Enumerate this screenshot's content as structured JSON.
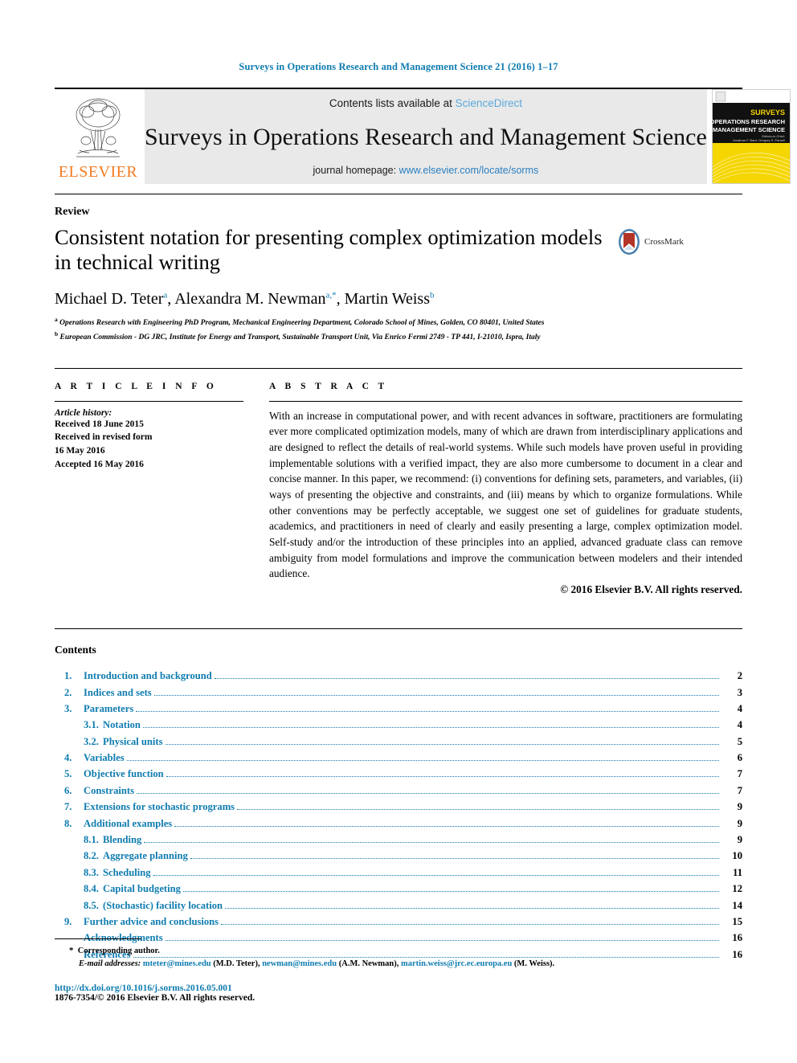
{
  "running_head": "Surveys in Operations Research and Management Science 21 (2016) 1–17",
  "masthead": {
    "publisher_name": "ELSEVIER",
    "contents_prefix": "Contents lists available at ",
    "sciencedirect": "ScienceDirect",
    "journal_title": "Surveys in Operations Research and Management Science",
    "homepage_prefix": "journal homepage: ",
    "homepage_url": "www.elsevier.com/locate/sorms",
    "cover": {
      "line1": "SURVEYS",
      "line2": "in OPERATIONS RESEARCH",
      "line3": "and MANAGEMENT SCIENCE",
      "sub1": "Editors-in-Chief:",
      "sub2": "Jonathan F. Bard, Gregory S. Parnell"
    }
  },
  "article": {
    "type": "Review",
    "title": "Consistent notation for presenting complex optimization models in technical writing",
    "crossmark_label": "CrossMark",
    "authors": [
      {
        "name": "Michael D. Teter",
        "marks": "a"
      },
      {
        "name": "Alexandra M. Newman",
        "marks": "a,*"
      },
      {
        "name": "Martin Weiss",
        "marks": "b"
      }
    ],
    "affiliations": [
      {
        "mark": "a",
        "text": "Operations Research with Engineering PhD Program, Mechanical Engineering Department, Colorado School of Mines, Golden, CO 80401, United States"
      },
      {
        "mark": "b",
        "text": "European Commission - DG JRC, Institute for Energy and Transport, Sustainable Transport Unit, Via Enrico Fermi 2749 - TP 441, I-21010, Ispra, Italy"
      }
    ]
  },
  "article_info": {
    "heading": "A R T I C L E   I N F O",
    "history_label": "Article history:",
    "history": [
      "Received 18 June 2015",
      "Received in revised form",
      "16 May 2016",
      "Accepted 16 May 2016"
    ]
  },
  "abstract": {
    "heading": "A B S T R A C T",
    "body": "With an increase in computational power, and with recent advances in software, practitioners are formulating ever more complicated optimization models, many of which are drawn from interdisciplinary applications and are designed to reflect the details of real-world systems. While such models have proven useful in providing implementable solutions with a verified impact, they are also more cumbersome to document in a clear and concise manner. In this paper, we recommend: (i) conventions for defining sets, parameters, and variables, (ii) ways of presenting the objective and constraints, and (iii) means by which to organize formulations. While other conventions may be perfectly acceptable, we suggest one set of guidelines for graduate students, academics, and practitioners in need of clearly and easily presenting a large, complex optimization model. Self-study and/or the introduction of these principles into an applied, advanced graduate class can remove ambiguity from model formulations and improve the communication between modelers and their intended audience.",
    "copyright": "© 2016 Elsevier B.V. All rights reserved."
  },
  "contents": {
    "title": "Contents",
    "entries": [
      {
        "num": "1.",
        "label": "Introduction and background",
        "page": "2",
        "sub": false
      },
      {
        "num": "2.",
        "label": "Indices and sets",
        "page": "3",
        "sub": false
      },
      {
        "num": "3.",
        "label": "Parameters",
        "page": "4",
        "sub": false
      },
      {
        "num": "3.1.",
        "label": "Notation",
        "page": "4",
        "sub": true
      },
      {
        "num": "3.2.",
        "label": "Physical units",
        "page": "5",
        "sub": true
      },
      {
        "num": "4.",
        "label": "Variables",
        "page": "6",
        "sub": false
      },
      {
        "num": "5.",
        "label": "Objective function",
        "page": "7",
        "sub": false
      },
      {
        "num": "6.",
        "label": "Constraints",
        "page": "7",
        "sub": false
      },
      {
        "num": "7.",
        "label": "Extensions for stochastic programs",
        "page": "9",
        "sub": false
      },
      {
        "num": "8.",
        "label": "Additional examples",
        "page": "9",
        "sub": false
      },
      {
        "num": "8.1.",
        "label": "Blending",
        "page": "9",
        "sub": true
      },
      {
        "num": "8.2.",
        "label": "Aggregate planning",
        "page": "10",
        "sub": true
      },
      {
        "num": "8.3.",
        "label": "Scheduling",
        "page": "11",
        "sub": true
      },
      {
        "num": "8.4.",
        "label": "Capital budgeting",
        "page": "12",
        "sub": true
      },
      {
        "num": "8.5.",
        "label": "(Stochastic) facility location",
        "page": "14",
        "sub": true
      },
      {
        "num": "9.",
        "label": "Further advice and conclusions",
        "page": "15",
        "sub": false
      },
      {
        "num": "",
        "label": "Acknowledgments",
        "page": "16",
        "sub": false
      },
      {
        "num": "",
        "label": "References",
        "page": "16",
        "sub": false
      }
    ]
  },
  "footnotes": {
    "corresponding_star": "*",
    "corresponding_text": "Corresponding author.",
    "email_label": "E-mail addresses:",
    "emails": [
      {
        "address": "mteter@mines.edu",
        "owner": "(M.D. Teter),"
      },
      {
        "address": "newman@mines.edu",
        "owner": "(A.M. Newman),"
      },
      {
        "address": "martin.weiss@jrc.ec.europa.eu",
        "owner": "(M. Weiss)."
      }
    ],
    "doi": "http://dx.doi.org/10.1016/j.sorms.2016.05.001",
    "issn_line": "1876-7354/© 2016 Elsevier B.V. All rights reserved."
  },
  "colors": {
    "link_blue": "#0f7cb0",
    "sciencedirect_blue": "#5aa9dd",
    "elsevier_orange": "#F47C20",
    "cover_yellow": "#f5d600"
  }
}
